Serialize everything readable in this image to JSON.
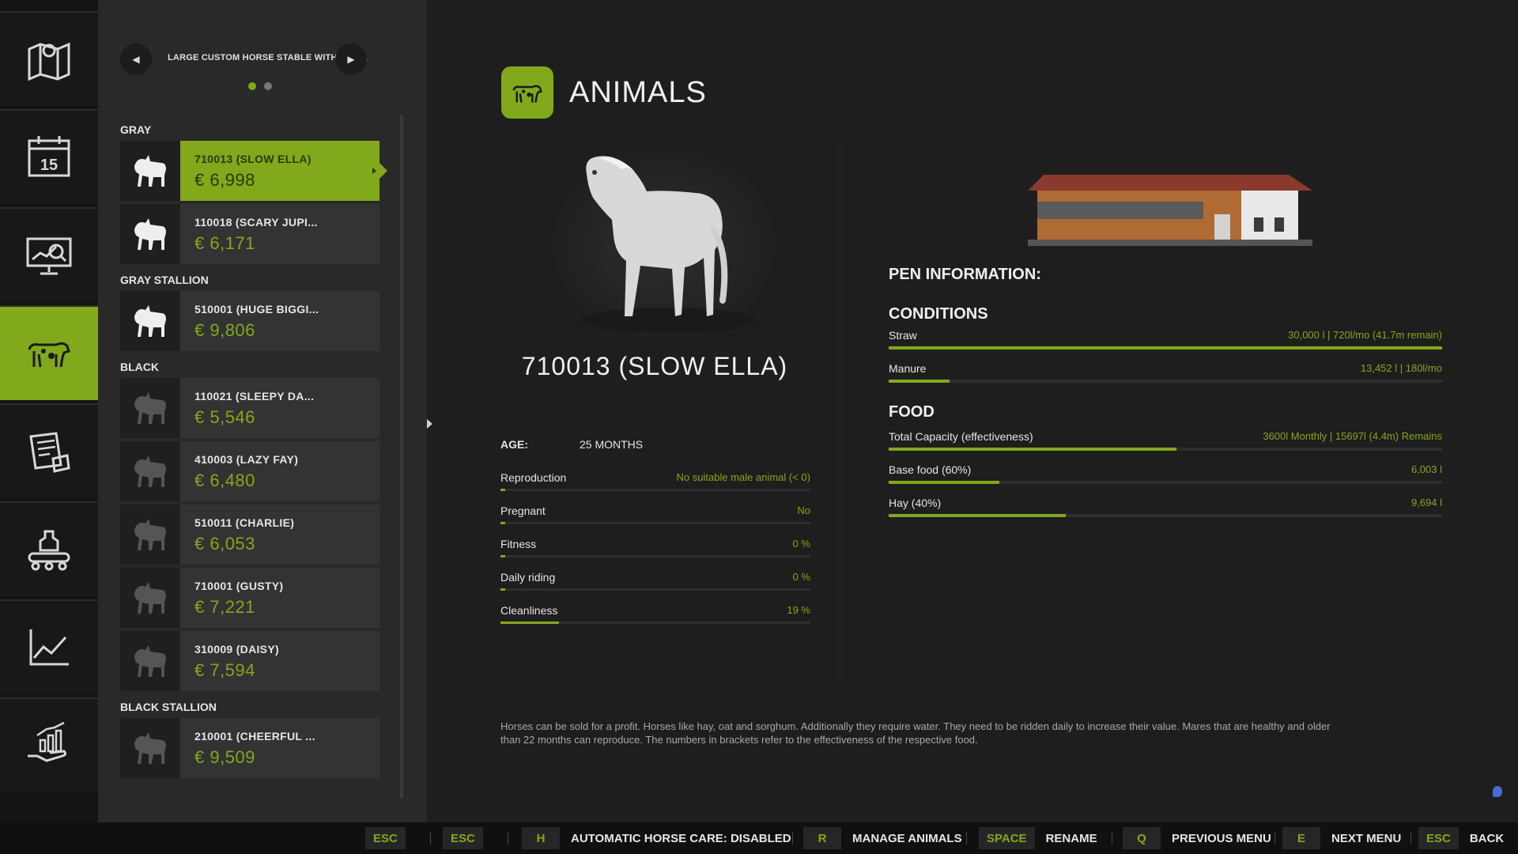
{
  "rail": {
    "items": [
      {
        "icon": "map-icon"
      },
      {
        "icon": "calendar-icon",
        "text": "15"
      },
      {
        "icon": "statistics-icon"
      },
      {
        "icon": "animals-icon"
      },
      {
        "icon": "contracts-icon"
      },
      {
        "icon": "production-icon"
      },
      {
        "icon": "prices-icon"
      },
      {
        "icon": "finances-icon"
      }
    ],
    "active_index": 3
  },
  "list": {
    "stable_name": "LARGE CUSTOM HORSE STABLE WITH MAN...",
    "prev_icon": "◀",
    "next_icon": "▶",
    "page_count": 2,
    "current_page": 0,
    "groups": [
      {
        "title": "GRAY",
        "animals": [
          {
            "name": "710013 (SLOW ELLA)",
            "price": "€ 6,998",
            "coat": "gray"
          },
          {
            "name": "110018 (SCARY JUPI...",
            "price": "€ 6,171",
            "coat": "gray"
          }
        ]
      },
      {
        "title": "GRAY STALLION",
        "animals": [
          {
            "name": "510001 (HUGE BIGGI...",
            "price": "€ 9,806",
            "coat": "gray"
          }
        ]
      },
      {
        "title": "BLACK",
        "animals": [
          {
            "name": "110021 (SLEEPY DA...",
            "price": "€ 5,546",
            "coat": "black"
          },
          {
            "name": "410003 (LAZY FAY)",
            "price": "€ 6,480",
            "coat": "black"
          },
          {
            "name": "510011 (CHARLIE)",
            "price": "€ 6,053",
            "coat": "black"
          },
          {
            "name": "710001 (GUSTY)",
            "price": "€ 7,221",
            "coat": "black"
          },
          {
            "name": "310009 (DAISY)",
            "price": "€ 7,594",
            "coat": "black"
          }
        ]
      },
      {
        "title": "BLACK STALLION",
        "animals": [
          {
            "name": "210001 (CHEERFUL ...",
            "price": "€ 9,509",
            "coat": "black"
          }
        ]
      }
    ]
  },
  "main": {
    "title": "ANIMALS",
    "animal_title": "710013 (SLOW ELLA)",
    "age_label": "AGE:",
    "age_value": "25 MONTHS",
    "stats": [
      {
        "label": "Reproduction",
        "value": "No suitable male animal (< 0)",
        "fill": 0.0
      },
      {
        "label": "Pregnant",
        "value": "No",
        "fill": 0.0
      },
      {
        "label": "Fitness",
        "value": "0 %",
        "fill": 0.0
      },
      {
        "label": "Daily riding",
        "value": "0 %",
        "fill": 0.0
      },
      {
        "label": "Cleanliness",
        "value": "19 %",
        "fill": 0.19
      }
    ],
    "description": "Horses can be sold for a profit. Horses like hay, oat and sorghum. Additionally they require water. They need to be ridden daily to increase their value. Mares that are healthy and older than 22 months can reproduce. The numbers in brackets refer to the effectiveness of the respective food."
  },
  "pen": {
    "heading": "PEN INFORMATION:",
    "conditions_heading": "CONDITIONS",
    "conditions": [
      {
        "label": "Straw",
        "value": "30,000 l  |  720l/mo (41.7m remain)",
        "fill": 1.0
      },
      {
        "label": "Manure",
        "value": "13,452 l  |  180l/mo",
        "fill": 0.11
      }
    ],
    "food_heading": "FOOD",
    "food": [
      {
        "label": "Total Capacity (effectiveness)",
        "value": "3600l Monthly | 15697l (4.4m) Remains",
        "fill": 0.52
      },
      {
        "label": "Base food (60%)",
        "value": "6,003 l",
        "fill": 0.2
      },
      {
        "label": "Hay (40%)",
        "value": "9,694 l",
        "fill": 0.32
      }
    ]
  },
  "hotkeys": [
    {
      "key": "ESC",
      "label": ""
    },
    {
      "key": "ESC",
      "label": ""
    },
    {
      "key": "H",
      "label": "AUTOMATIC HORSE CARE: DISABLED"
    },
    {
      "key": "R",
      "label": "MANAGE ANIMALS"
    },
    {
      "key": "SPACE",
      "label": "RENAME"
    },
    {
      "key": "Q",
      "label": "PREVIOUS MENU"
    },
    {
      "key": "E",
      "label": "NEXT MENU"
    },
    {
      "key": "ESC",
      "label": "BACK"
    }
  ],
  "colors": {
    "accent": "#82a81b",
    "background": "#1e1e1e",
    "panel": "#292929"
  }
}
